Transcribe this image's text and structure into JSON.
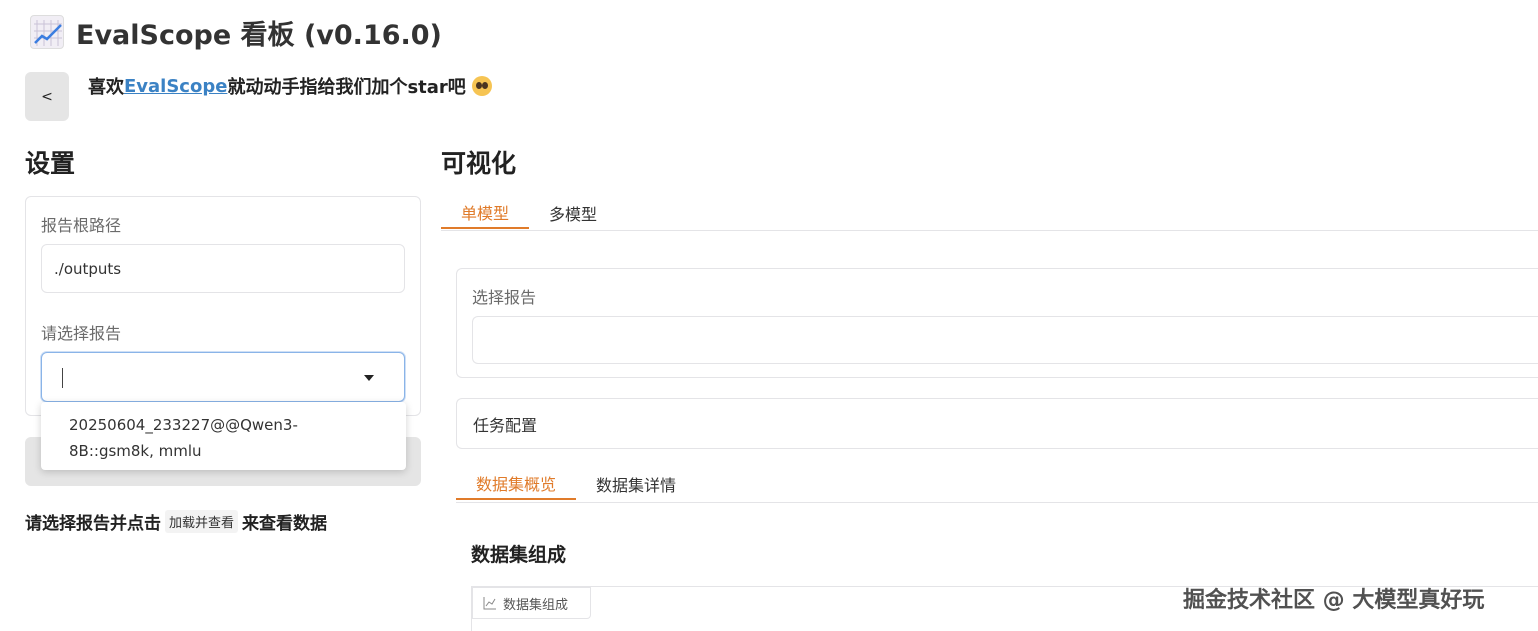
{
  "header": {
    "title": "EvalScope 看板 (v0.16.0)",
    "star_prefix": "喜欢",
    "star_link": "EvalScope",
    "star_suffix": "就动动手指给我们加个star吧",
    "collapse_label": "<"
  },
  "settings": {
    "title": "设置",
    "root_path_label": "报告根路径",
    "root_path_value": "./outputs",
    "select_report_label": "请选择报告",
    "select_report_value": "",
    "dropdown_options": [
      "20250604_233227@@Qwen3-8B::gsm8k, mmlu"
    ],
    "hint_prefix": "请选择报告并点击",
    "hint_code": "加载并查看",
    "hint_suffix": "来查看数据"
  },
  "visualization": {
    "title": "可视化",
    "tabs": [
      {
        "label": "单模型",
        "active": true
      },
      {
        "label": "多模型",
        "active": false
      }
    ],
    "select_report_label": "选择报告",
    "task_config_label": "任务配置",
    "sub_tabs": [
      {
        "label": "数据集概览",
        "active": true
      },
      {
        "label": "数据集详情",
        "active": false
      }
    ],
    "dataset_composition_heading": "数据集组成",
    "plot_chip_label": "数据集组成"
  },
  "watermark": "掘金技术社区 @ 大模型真好玩",
  "colors": {
    "accent": "#e07b2a",
    "link": "#3b82c4",
    "focus_border": "#8ab4e8"
  }
}
